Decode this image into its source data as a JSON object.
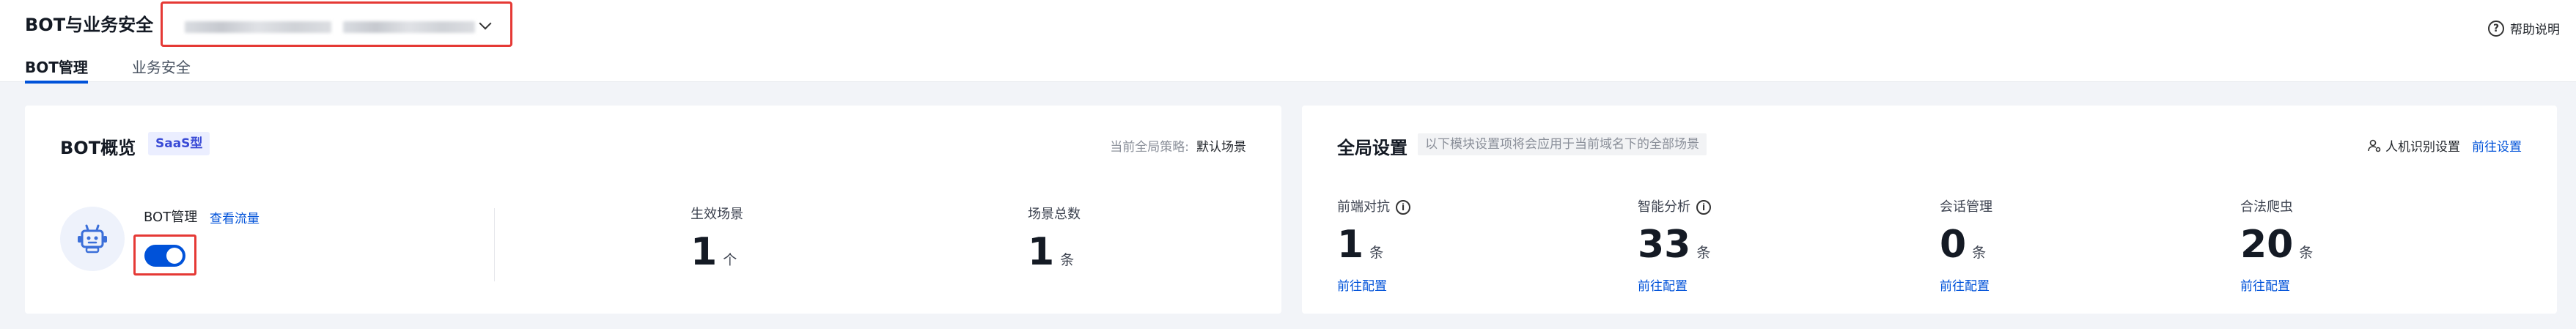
{
  "header": {
    "title": "BOT与业务安全",
    "help_label": "帮助说明"
  },
  "tabs": [
    {
      "label": "BOT管理",
      "active": true
    },
    {
      "label": "业务安全",
      "active": false
    }
  ],
  "bot_overview": {
    "title": "BOT概览",
    "tag": "SaaS型",
    "strategy_label": "当前全局策略:",
    "strategy_value": "默认场景",
    "bot_management_label": "BOT管理",
    "view_traffic_link": "查看流量",
    "toggle_on": true,
    "effective_scenes_label": "生效场景",
    "effective_scenes_value": "1",
    "effective_scenes_unit": "个",
    "total_scenes_label": "场景总数",
    "total_scenes_value": "1",
    "total_scenes_unit": "条"
  },
  "global_settings": {
    "title": "全局设置",
    "hint": "以下模块设置项将会应用于当前域名下的全部场景",
    "captcha_label": "人机识别设置",
    "captcha_link": "前往设置",
    "items": [
      {
        "label": "前端对抗",
        "value": "1",
        "unit": "条",
        "link": "前往配置",
        "info": true
      },
      {
        "label": "智能分析",
        "value": "33",
        "unit": "条",
        "link": "前往配置",
        "info": true
      },
      {
        "label": "会话管理",
        "value": "0",
        "unit": "条",
        "link": "前往配置",
        "info": false
      },
      {
        "label": "合法爬虫",
        "value": "20",
        "unit": "条",
        "link": "前往配置",
        "info": false
      }
    ]
  },
  "colors": {
    "primary": "#0052d9",
    "highlight_border": "#e53935"
  }
}
